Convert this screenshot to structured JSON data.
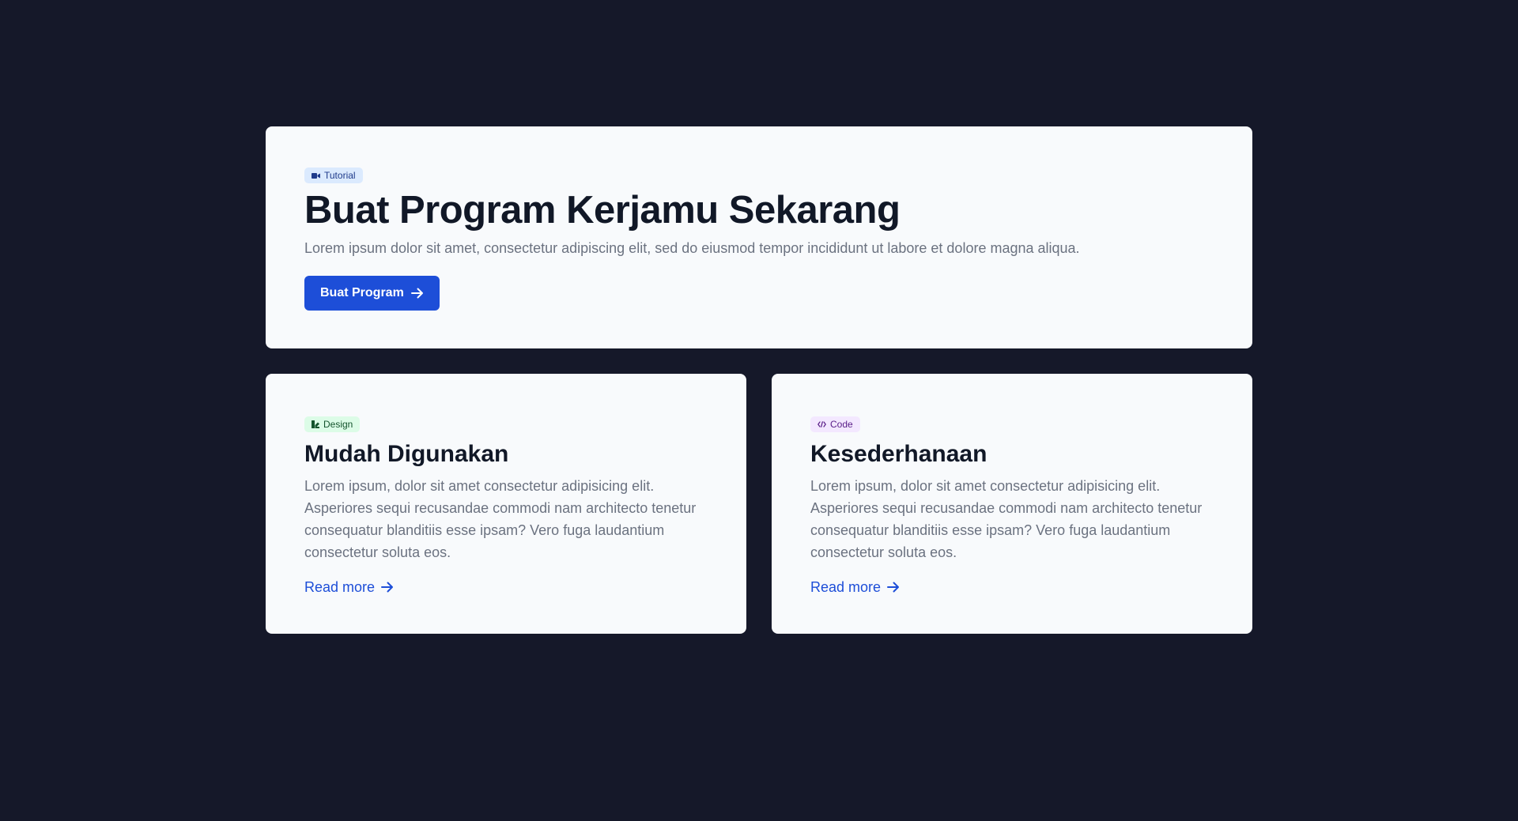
{
  "hero": {
    "badge": "Tutorial",
    "badge_icon": "video-camera-icon",
    "title": "Buat Program Kerjamu Sekarang",
    "description": "Lorem ipsum dolor sit amet, consectetur adipiscing elit, sed do eiusmod tempor incididunt ut labore et dolore magna aliqua.",
    "button_label": "Buat Program",
    "button_icon": "arrow-right-icon"
  },
  "features": [
    {
      "badge": "Design",
      "badge_icon": "design-icon",
      "title": "Mudah Digunakan",
      "description": "Lorem ipsum, dolor sit amet consectetur adipisicing elit. Asperiores sequi recusandae commodi nam architecto tenetur consequatur blanditiis esse ipsam? Vero fuga laudantium consectetur soluta eos.",
      "link_label": "Read more"
    },
    {
      "badge": "Code",
      "badge_icon": "code-icon",
      "title": "Kesederhanaan",
      "description": "Lorem ipsum, dolor sit amet consectetur adipisicing elit. Asperiores sequi recusandae commodi nam architecto tenetur consequatur blanditiis esse ipsam? Vero fuga laudantium consectetur soluta eos.",
      "link_label": "Read more"
    }
  ],
  "colors": {
    "background": "#151829",
    "card": "#f8fafc",
    "accent": "#1d4ed8",
    "heading": "#111827",
    "body_text": "#6b7280"
  }
}
